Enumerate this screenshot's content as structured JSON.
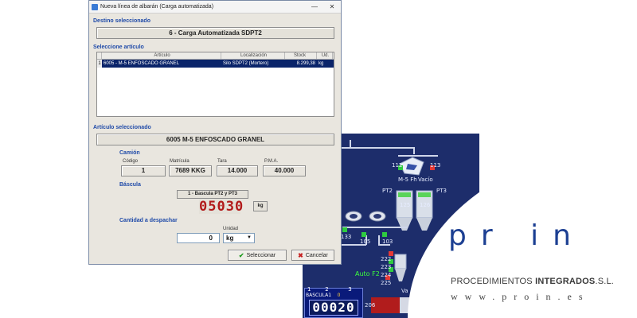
{
  "dialog": {
    "title": "Nueva línea de albarán (Carga automatizada)",
    "window_buttons": {
      "minimize": "—",
      "close": "✕"
    },
    "destino": {
      "label": "Destino seleccionado",
      "value": "6 - Carga Automatizada SDPT2"
    },
    "articulo_section": {
      "label": "Seleccione artículo"
    },
    "grid": {
      "columns": [
        "Artículo",
        "Localización",
        "Stock",
        "Ud."
      ],
      "rows": [
        {
          "marker": "1",
          "articulo": "6005 - M-5 ENFOSCADO GRANEL",
          "localizacion": "Silo SDPT2 (Mortero)",
          "stock": "8.299,38",
          "ud": "kg"
        }
      ]
    },
    "articulo_seleccionado": {
      "label": "Artículo seleccionado",
      "value": "6005 M-5 ENFOSCADO GRANEL"
    },
    "camion": {
      "label": "Camión",
      "codigo": {
        "label": "Código",
        "value": "1"
      },
      "matricula": {
        "label": "Matrícula",
        "value": "7689 KKG"
      },
      "tara": {
        "label": "Tara",
        "value": "14.000"
      },
      "pma": {
        "label": "P.M.A.",
        "value": "40.000"
      }
    },
    "bascula": {
      "label": "Báscula",
      "selected": "1 - Bascula PT2 y PT3",
      "reading": "05030",
      "unit": "kg"
    },
    "cantidad": {
      "label": "Cantidad a despachar",
      "value": "0",
      "unit_label": "Unidad",
      "unit": "kg"
    },
    "buttons": {
      "select": "Seleccionar",
      "cancel": "Cancelar"
    }
  },
  "scada": {
    "labels": {
      "m5": "M-5 Fh",
      "vacio": "Vacío",
      "pt2": "PT2",
      "pt3": "PT3",
      "auto": "Auto F2",
      "bascula": "BASCULA1",
      "n1": "1",
      "n2": "2",
      "n3": "3",
      "val": "0",
      "va": "Va"
    },
    "tags": [
      "112",
      "113",
      "125",
      "126",
      "105",
      "103",
      "133",
      "222",
      "223",
      "224",
      "225",
      "206"
    ],
    "bascula_display": "00020"
  },
  "brand": {
    "logo": "pr in",
    "tagline_prefix": "PROCEDIMIENTOS ",
    "tagline_bold": "INTEGRADOS",
    "tagline_suffix": ".S.L.",
    "url": "www.proin.es",
    "colors": {
      "logo": "#1c3f92"
    }
  }
}
